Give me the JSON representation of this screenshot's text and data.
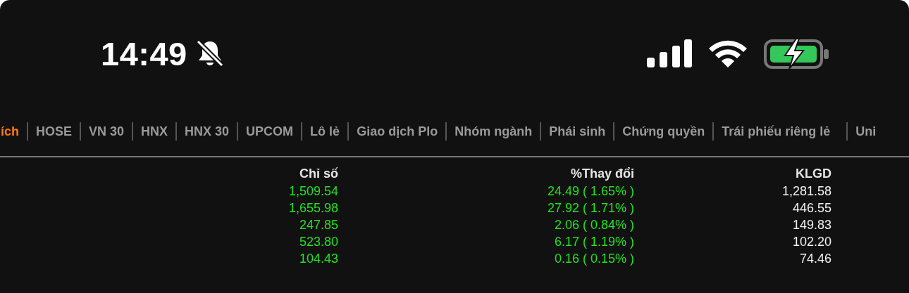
{
  "status_bar": {
    "time": "14:49"
  },
  "tabs": [
    {
      "label": "ích",
      "selected": true
    },
    {
      "label": "HOSE",
      "selected": false
    },
    {
      "label": "VN 30",
      "selected": false
    },
    {
      "label": "HNX",
      "selected": false
    },
    {
      "label": "HNX 30",
      "selected": false
    },
    {
      "label": "UPCOM",
      "selected": false
    },
    {
      "label": "Lô lẻ",
      "selected": false
    },
    {
      "label": "Giao dịch Plo",
      "selected": false
    },
    {
      "label": "Nhóm ngành",
      "selected": false
    },
    {
      "label": "Phái sinh",
      "selected": false
    },
    {
      "label": "Chứng quyền",
      "selected": false
    },
    {
      "label": "Trái phiếu riêng lẻ",
      "selected": false
    },
    {
      "label": "Uni",
      "selected": false
    }
  ],
  "table": {
    "columns": [
      "Chỉ số",
      "%Thay đổi",
      "KLGD"
    ],
    "rows": [
      {
        "index": "1,509.54",
        "change": "24.49 ( 1.65% )",
        "volume": "1,281.58"
      },
      {
        "index": "1,655.98",
        "change": "27.92 ( 1.71% )",
        "volume": "446.55"
      },
      {
        "index": "247.85",
        "change": "2.06 ( 0.84% )",
        "volume": "149.83"
      },
      {
        "index": "523.80",
        "change": "6.17 ( 1.19% )",
        "volume": "102.20"
      },
      {
        "index": "104.43",
        "change": "0.16 ( 0.15% )",
        "volume": "74.46"
      }
    ]
  }
}
